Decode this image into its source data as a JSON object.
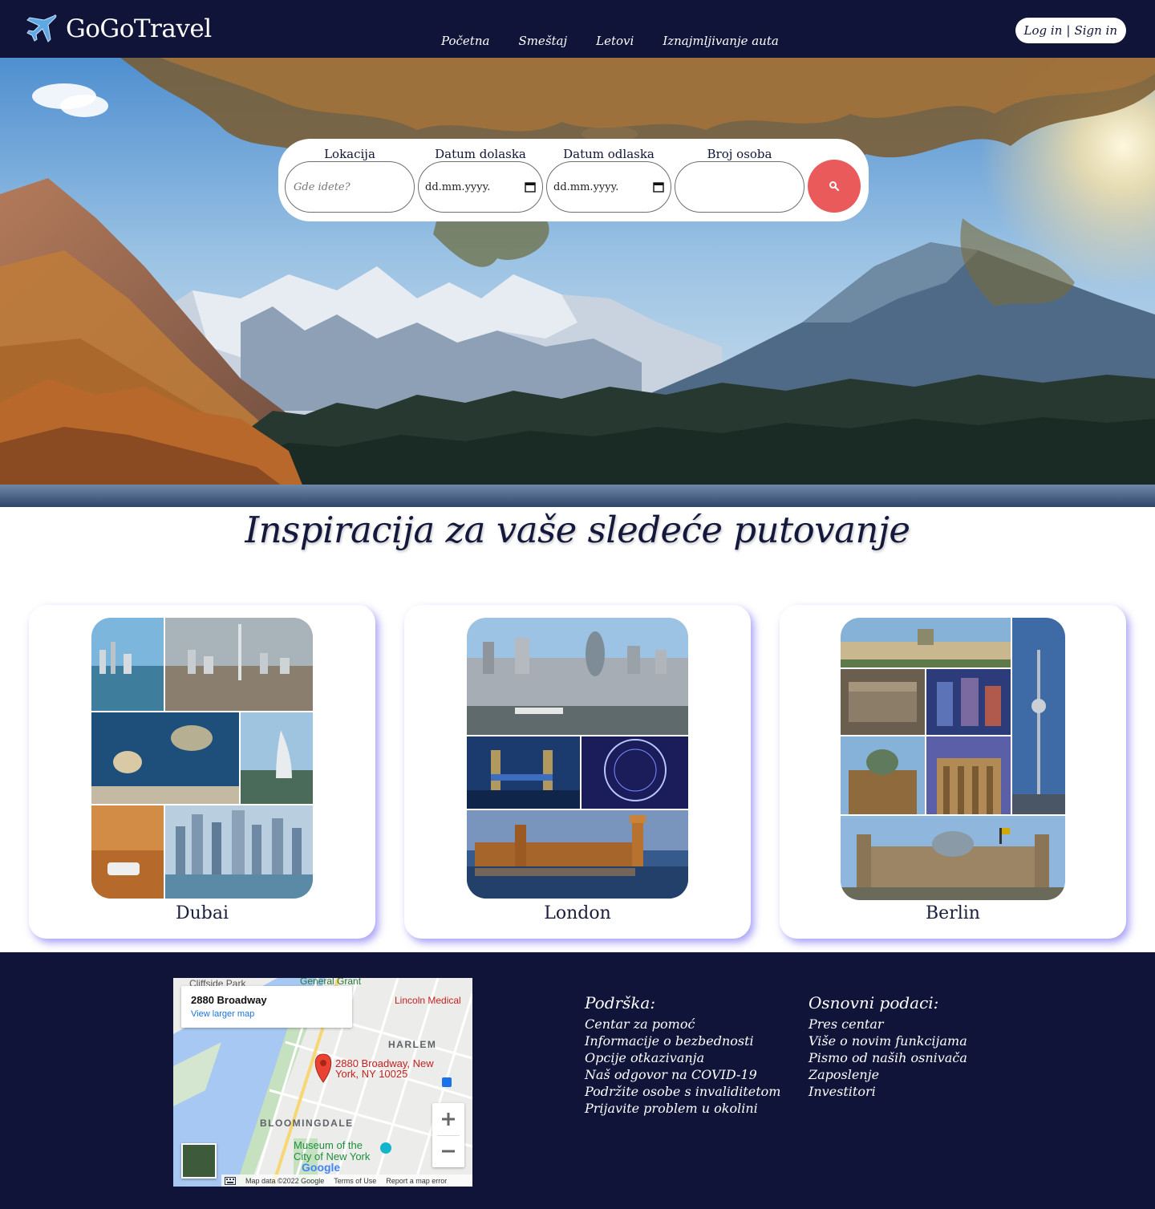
{
  "brand": {
    "name": "GoGoTravel",
    "logo_icon": "airplane-icon"
  },
  "nav": {
    "links": [
      "Početna",
      "Smeštaj",
      "Letovi",
      "Iznajmljivanje auta"
    ],
    "login": "Log in",
    "separator": "|",
    "signin": "Sign in"
  },
  "search": {
    "location_label": "Lokacija",
    "location_placeholder": "Gde idete?",
    "arrival_label": "Datum dolaska",
    "arrival_value": "dd.mm.yyyy.",
    "departure_label": "Datum odlaska",
    "departure_value": "dd.mm.yyyy.",
    "persons_label": "Broj osoba",
    "persons_value": "",
    "button_icon": "search-icon"
  },
  "inspiration": {
    "title": "Inspiracija za vaše sledeće putovanje",
    "cards": [
      {
        "name": "Dubai"
      },
      {
        "name": "London"
      },
      {
        "name": "Berlin"
      }
    ]
  },
  "map": {
    "address_title": "2880 Broadway",
    "larger_map": "View larger map",
    "pin_label_1": "2880 Broadway, New",
    "pin_label_2": "York, NY 10025",
    "place_harlem": "HARLEM",
    "place_bloomingdale": "BLOOMINGDALE",
    "place_museum_1": "Museum of the",
    "place_museum_2": "City of New York",
    "place_cliffside": "Cliffside Park",
    "place_general_grant": "General Grant",
    "place_lincoln": "Lincoln Medical",
    "footer_data": "Map data ©2022 Google",
    "footer_terms": "Terms of Use",
    "footer_report": "Report a map error",
    "google": "Google"
  },
  "footer": {
    "support_title": "Podrška:",
    "support_links": [
      "Centar za pomoć",
      "Informacije o bezbednosti",
      "Opcije otkazivanja",
      "Naš odgovor na COVID-19",
      "Podržite osobe s invaliditetom",
      "Prijavite problem u okolini"
    ],
    "basic_title": "Osnovni podaci:",
    "basic_links": [
      "Pres centar",
      "Više o novim funkcijama",
      "Pismo od naših osnivača",
      "Zaposlenje",
      "Investitori"
    ]
  },
  "colors": {
    "navy": "#0f1438",
    "search_button": "#ea5a5b",
    "card_shadow": "#786ef0"
  }
}
